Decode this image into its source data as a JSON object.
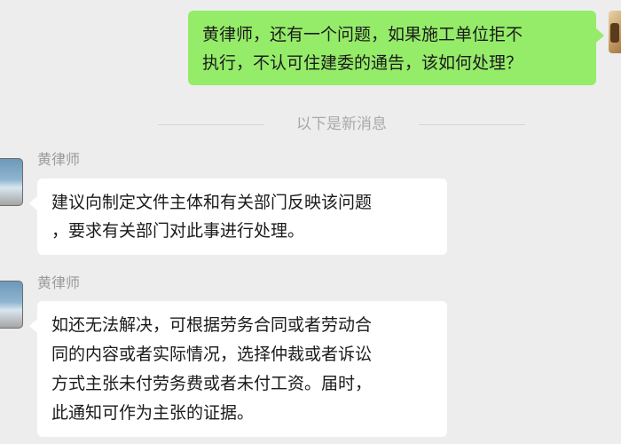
{
  "outgoing": {
    "lines": [
      "黄律师，还有一个问题，如果施工单位拒不",
      "执行，不认可住建委的通告，该如何处理？"
    ]
  },
  "divider": {
    "label": "以下是新消息"
  },
  "incoming": [
    {
      "sender": "黄律师",
      "lines": [
        "建议向制定文件主体和有关部门反映该问题",
        "，要求有关部门对此事进行处理。"
      ]
    },
    {
      "sender": "黄律师",
      "lines": [
        "如还无法解决，可根据劳务合同或者劳动合",
        "同的内容或者实际情况，选择仲裁或者诉讼",
        "方式主张未付劳务费或者未付工资。届时，",
        "此通知可作为主张的证据。"
      ]
    }
  ]
}
